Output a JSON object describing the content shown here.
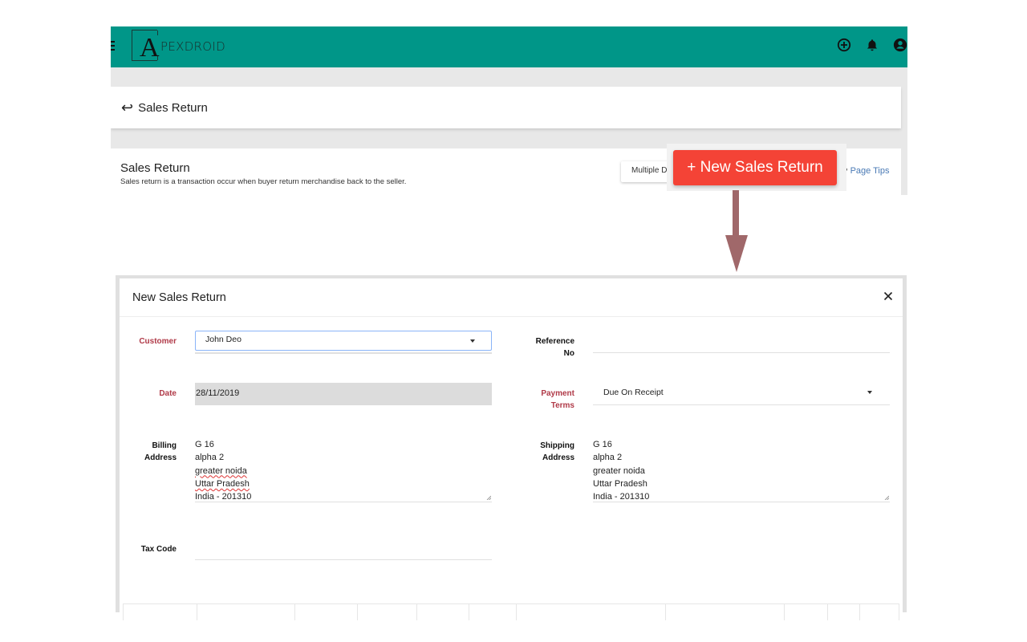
{
  "app": {
    "brand_initial": "A",
    "brand_rest": "PEXDROID",
    "colors": {
      "topbar": "#009688",
      "primary_button": "#f44336",
      "required_label": "#b03a48",
      "link": "#4a7ab5",
      "annotation_arrow": "#a0686a"
    },
    "top_icons": [
      "add-circle-icon",
      "bell-icon",
      "account-icon"
    ]
  },
  "page_header": {
    "back_icon": "back-arrow-icon",
    "back_glyph": "↩",
    "title": "Sales Return"
  },
  "info_card": {
    "heading": "Sales Return",
    "description": "Sales return is a transaction occur when buyer return merchandise back to the seller.",
    "multiple_button_label": "Multiple D",
    "new_button_label": "+ New Sales Return",
    "page_tips_icon_glyph": "?",
    "page_tips_label": "Page Tips"
  },
  "modal": {
    "title": "New Sales Return",
    "close_icon": "close-icon",
    "fields": {
      "customer": {
        "label": "Customer",
        "required": true,
        "value": "John Deo"
      },
      "reference_no": {
        "label_line1": "Reference",
        "label_line2": "No",
        "required": false,
        "value": ""
      },
      "date": {
        "label": "Date",
        "required": true,
        "value": "28/11/2019"
      },
      "payment_terms": {
        "label_line1": "Payment",
        "label_line2": "Terms",
        "required": true,
        "value": "Due On Receipt"
      },
      "billing_address": {
        "label_line1": "Billing",
        "label_line2": "Address",
        "lines": [
          "G 16",
          "alpha 2",
          "greater noida",
          "Uttar Pradesh",
          "India - 201310"
        ]
      },
      "shipping_address": {
        "label_line1": "Shipping",
        "label_line2": "Address",
        "lines": [
          "G 16",
          "alpha 2",
          "greater noida",
          "Uttar Pradesh",
          "India - 201310"
        ]
      },
      "tax_code": {
        "label": "Tax Code",
        "required": false,
        "value": ""
      }
    }
  }
}
